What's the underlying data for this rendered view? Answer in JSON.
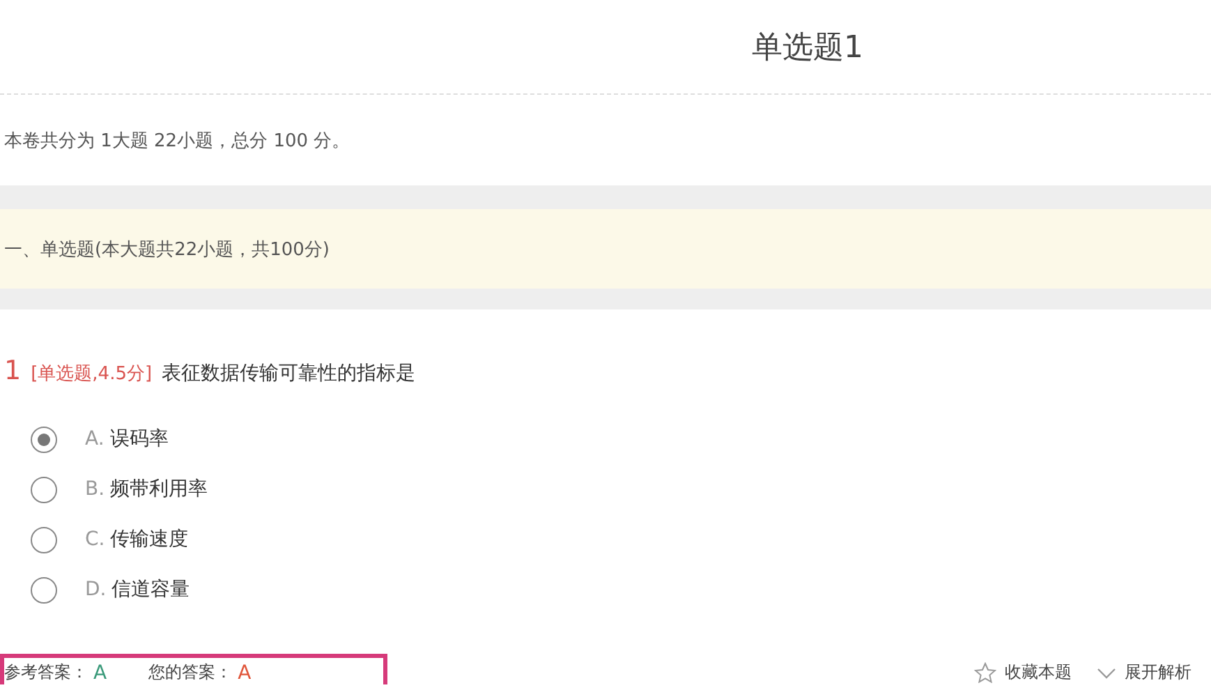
{
  "title": "单选题1",
  "summary": "本卷共分为 1大题 22小题，总分 100 分。",
  "section": "一、单选题(本大题共22小题，共100分)",
  "question": {
    "number": "1",
    "tag": "[单选题,4.5分]",
    "text": "表征数据传输可靠性的指标是",
    "options": [
      {
        "letter": "A.",
        "text": "误码率",
        "selected": true
      },
      {
        "letter": "B.",
        "text": "频带利用率",
        "selected": false
      },
      {
        "letter": "C.",
        "text": "传输速度",
        "selected": false
      },
      {
        "letter": "D.",
        "text": "信道容量",
        "selected": false
      }
    ]
  },
  "answer": {
    "reference_label": "参考答案：",
    "reference": "A",
    "yours_label": "您的答案：",
    "yours": "A"
  },
  "actions": [
    {
      "kind": "star",
      "label": "收藏本题"
    },
    {
      "kind": "expand",
      "label": "展开解析"
    }
  ]
}
